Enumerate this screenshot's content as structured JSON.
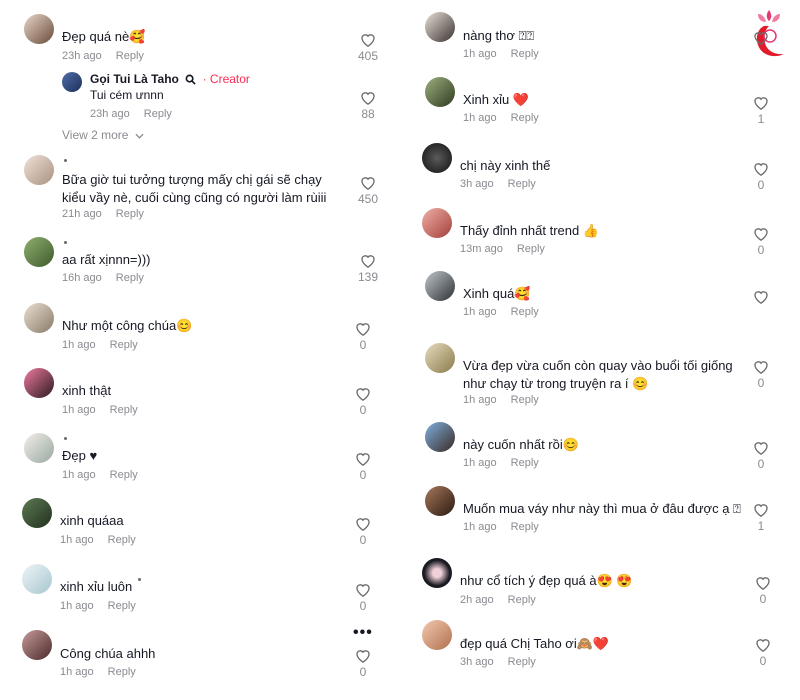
{
  "ui": {
    "reply_label": "Reply",
    "view_more": "View 2 more"
  },
  "colors": {
    "text": "#161823",
    "meta": "#8a8b91",
    "creator": "#fe2c55",
    "heart": "#e11d2c"
  },
  "icons": {
    "like": "heart-outline-icon",
    "more": "ellipsis-icon",
    "badge": "search-badge-icon",
    "logo": "woman-flower-logo"
  },
  "left": {
    "comments": [
      {
        "text": "Đẹp quá nè🥰",
        "time": "23h ago",
        "likes": "405"
      },
      {
        "text": "Bữa giờ tui tưởng tượng mấy chị gái sẽ chạy kiểu vầy nè, cuối cùng cũng có người làm rùiii",
        "time": "21h ago",
        "likes": "450"
      },
      {
        "text": "aa rất xịnnn=)))",
        "time": "16h ago",
        "likes": "139"
      },
      {
        "text": "Như một công chúa😊",
        "time": "1h ago",
        "likes": "0"
      },
      {
        "text": "xinh thật",
        "time": "1h ago",
        "likes": "0"
      },
      {
        "text": "Đẹp ♥",
        "time": "1h ago",
        "likes": "0"
      },
      {
        "text": "xinh quáaa",
        "time": "1h ago",
        "likes": "0"
      },
      {
        "text": "xinh xỉu luôn",
        "time": "1h ago",
        "likes": "0"
      },
      {
        "text": "Công chúa ahhh",
        "time": "1h ago",
        "likes": "0"
      }
    ],
    "reply": {
      "author": "Gọi Tui Là Taho",
      "creator_label": "· Creator",
      "text": "Tui cém ưnnn",
      "time": "23h ago",
      "likes": "88"
    }
  },
  "right": {
    "comments": [
      {
        "text": "nàng thơ ⍰⍰",
        "time": "1h ago",
        "likes": ""
      },
      {
        "text": "Xinh xỉu ❤️",
        "time": "1h ago",
        "likes": "1"
      },
      {
        "text": "chị này xinh thế",
        "time": "3h ago",
        "likes": "0"
      },
      {
        "text": "Thấy đỉnh nhất trend 👍",
        "time": "13m ago",
        "likes": "0"
      },
      {
        "text": "Xinh quá🥰",
        "time": "1h ago",
        "likes": ""
      },
      {
        "text": "Vừa đẹp vừa cuốn còn quay vào buổi tối giống như chạy từ trong truyện ra í 😊",
        "time": "1h ago",
        "likes": "0"
      },
      {
        "text": "này cuốn nhất rồi😊",
        "time": "1h ago",
        "likes": "0"
      },
      {
        "text": "Muốn mua váy như này thì mua ở đâu được ạ ⍰",
        "time": "1h ago",
        "likes": "1"
      },
      {
        "text": "như cổ tích ý đẹp quá à😍 😍",
        "time": "2h ago",
        "likes": "0"
      },
      {
        "text": "đẹp quá Chị Taho ơi🙈❤️",
        "time": "3h ago",
        "likes": "0"
      }
    ]
  }
}
